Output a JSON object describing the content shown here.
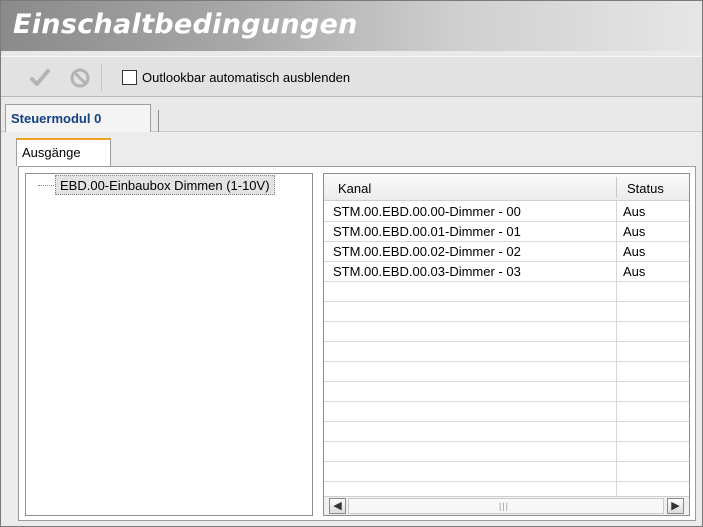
{
  "window": {
    "title": "Einschaltbedingungen"
  },
  "toolbar": {
    "confirm_icon": "checkmark-icon",
    "cancel_icon": "cancel-circle-icon",
    "autohide_label": "Outlookbar automatisch ausblenden",
    "autohide_checked": false
  },
  "tabs": {
    "module_tab": "Steuermodul 0",
    "sub_tab": "Ausgänge"
  },
  "tree": {
    "node": "EBD.00-Einbaubox Dimmen (1-10V)"
  },
  "list": {
    "columns": {
      "kanal": "Kanal",
      "status": "Status"
    },
    "rows": [
      {
        "kanal": "STM.00.EBD.00.00-Dimmer - 00",
        "status": "Aus"
      },
      {
        "kanal": "STM.00.EBD.00.01-Dimmer - 01",
        "status": "Aus"
      },
      {
        "kanal": "STM.00.EBD.00.02-Dimmer - 02",
        "status": "Aus"
      },
      {
        "kanal": "STM.00.EBD.00.03-Dimmer - 03",
        "status": "Aus"
      }
    ]
  },
  "colors": {
    "active_tab_text": "#123f85",
    "tab_highlight": "#f0a020"
  }
}
